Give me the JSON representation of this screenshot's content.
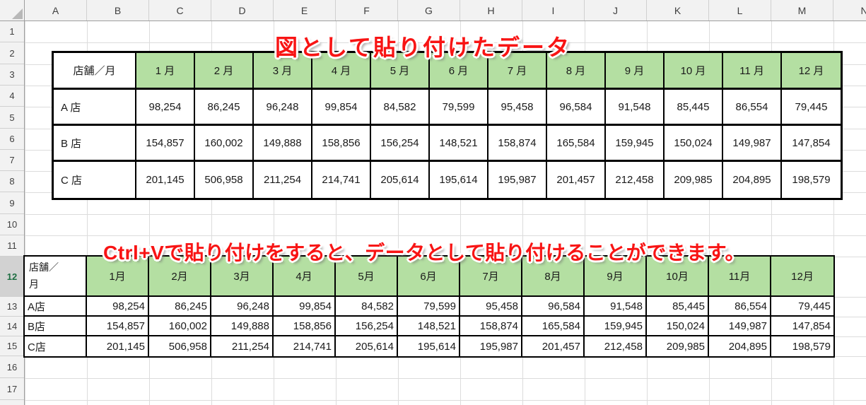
{
  "titles": {
    "pasted_as_image": "図として貼り付けたデータ",
    "paste_instruction": "Ctrl+Vで貼り付けをすると、データとして貼り付けることができます。"
  },
  "spreadsheet": {
    "column_headers": [
      "A",
      "B",
      "C",
      "D",
      "E",
      "F",
      "G",
      "H",
      "I",
      "J",
      "K",
      "L",
      "M",
      "N"
    ],
    "row_headers": [
      "1",
      "2",
      "3",
      "4",
      "5",
      "6",
      "7",
      "8",
      "9",
      "10",
      "11",
      "12",
      "13",
      "14",
      "15",
      "16",
      "17"
    ],
    "selected_row": "12"
  },
  "image_table": {
    "corner_label": "店舗／月",
    "month_headers": [
      "1 月",
      "2 月",
      "3 月",
      "4 月",
      "5 月",
      "6 月",
      "7 月",
      "8 月",
      "9 月",
      "10 月",
      "11 月",
      "12 月"
    ],
    "rows": [
      {
        "label": "A 店",
        "values": [
          "98,254",
          "86,245",
          "96,248",
          "99,854",
          "84,582",
          "79,599",
          "95,458",
          "96,584",
          "91,548",
          "85,445",
          "86,554",
          "79,445"
        ]
      },
      {
        "label": "B 店",
        "values": [
          "154,857",
          "160,002",
          "149,888",
          "158,856",
          "156,254",
          "148,521",
          "158,874",
          "165,584",
          "159,945",
          "150,024",
          "149,987",
          "147,854"
        ]
      },
      {
        "label": "C 店",
        "values": [
          "201,145",
          "506,958",
          "211,254",
          "214,741",
          "205,614",
          "195,614",
          "195,987",
          "201,457",
          "212,458",
          "209,985",
          "204,895",
          "198,579"
        ]
      }
    ]
  },
  "data_table": {
    "corner_label": "店舗／月",
    "month_headers": [
      "1月",
      "2月",
      "3月",
      "4月",
      "5月",
      "6月",
      "7月",
      "8月",
      "9月",
      "10月",
      "11月",
      "12月"
    ],
    "rows": [
      {
        "label": "A店",
        "values": [
          "98,254",
          "86,245",
          "96,248",
          "99,854",
          "84,582",
          "79,599",
          "95,458",
          "96,584",
          "91,548",
          "85,445",
          "86,554",
          "79,445"
        ]
      },
      {
        "label": "B店",
        "values": [
          "154,857",
          "160,002",
          "149,888",
          "158,856",
          "156,254",
          "148,521",
          "158,874",
          "165,584",
          "159,945",
          "150,024",
          "149,987",
          "147,854"
        ]
      },
      {
        "label": "C店",
        "values": [
          "201,145",
          "506,958",
          "211,254",
          "214,741",
          "205,614",
          "195,614",
          "195,987",
          "201,457",
          "212,458",
          "209,985",
          "204,895",
          "198,579"
        ]
      }
    ]
  },
  "colors": {
    "header_green": "#b4dfa2",
    "title_red": "#f81414",
    "selected_row_text_green": "#1e6e42",
    "grid_line": "#dcdcdc"
  }
}
